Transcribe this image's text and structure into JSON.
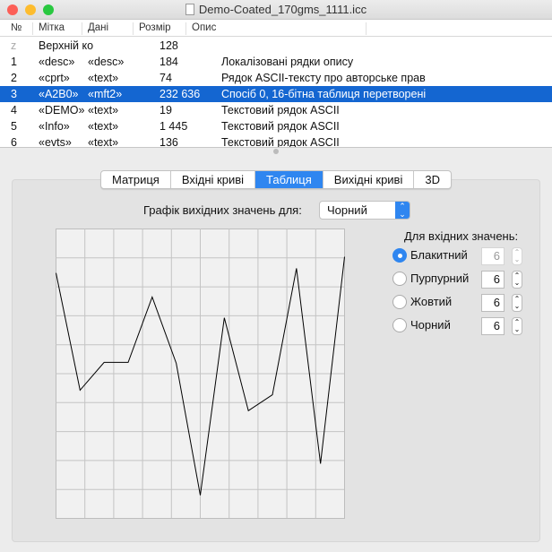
{
  "window": {
    "title": "Demo-Coated_170gms_1111.icc"
  },
  "table": {
    "headers": [
      "№",
      "Мітка",
      "Дані",
      "Розмір",
      "Опис"
    ],
    "rows": [
      {
        "n": "z",
        "tag": "Верхній ко",
        "data": "",
        "size": "128",
        "desc": ""
      },
      {
        "n": "1",
        "tag": "«desc»",
        "data": "«desc»",
        "size": "184",
        "desc": "Локалізовані рядки опису"
      },
      {
        "n": "2",
        "tag": "«cprt»",
        "data": "«text»",
        "size": "74",
        "desc": "Рядок ASCII-тексту про авторське прав"
      },
      {
        "n": "3",
        "tag": "«A2B0»",
        "data": "«mft2»",
        "size": "232 636",
        "desc": "Спосіб 0, 16-бітна таблиця перетворені"
      },
      {
        "n": "4",
        "tag": "«DEMO»",
        "data": "«text»",
        "size": "19",
        "desc": "Текстовий рядок ASCII"
      },
      {
        "n": "5",
        "tag": "«Info»",
        "data": "«text»",
        "size": "1 445",
        "desc": "Текстовий рядок ASCII"
      },
      {
        "n": "6",
        "tag": "«evts»",
        "data": "«text»",
        "size": "136",
        "desc": "Текстовий рядок ASCII"
      }
    ],
    "selected_index": 3
  },
  "tabs": [
    "Матриця",
    "Вхідні криві",
    "Таблиця",
    "Вихідні криві",
    "3D"
  ],
  "active_tab": 2,
  "graph_label": "Графік вихідних значень для:",
  "output_channel": "Чорний",
  "inputs": {
    "title": "Для вхідних значень:",
    "options": [
      {
        "name": "Блакитний",
        "value": "6",
        "selected": true
      },
      {
        "name": "Пурпурний",
        "value": "6",
        "selected": false
      },
      {
        "name": "Жовтий",
        "value": "6",
        "selected": false
      },
      {
        "name": "Чорний",
        "value": "6",
        "selected": false
      }
    ]
  },
  "chart_data": {
    "type": "line",
    "x": [
      0,
      1,
      2,
      3,
      4,
      5,
      6,
      7,
      8,
      9,
      10,
      11,
      12
    ],
    "values": [
      0.848,
      0.443,
      0.539,
      0.539,
      0.765,
      0.536,
      0.08,
      0.693,
      0.372,
      0.427,
      0.864,
      0.189,
      0.904
    ],
    "xlim": [
      0,
      12
    ],
    "ylim": [
      0,
      1
    ],
    "grid": true,
    "grid_divisions": 10
  }
}
